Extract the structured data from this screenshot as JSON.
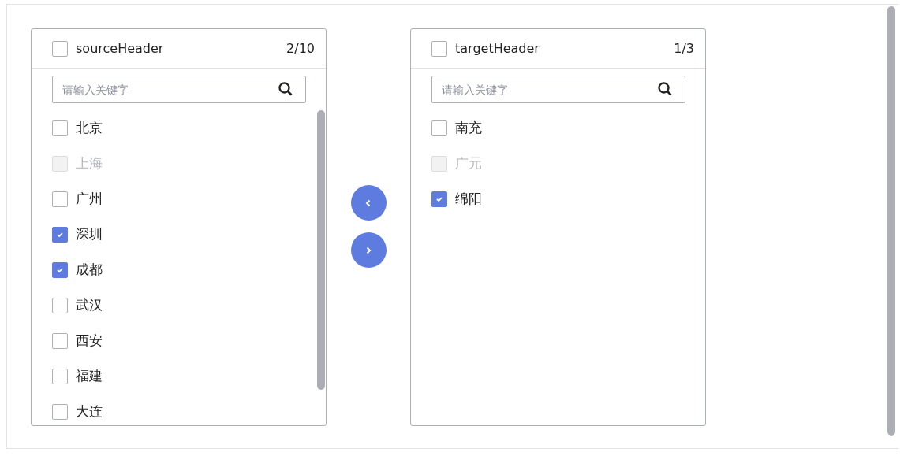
{
  "source": {
    "header": "sourceHeader",
    "checked": false,
    "count": "2/10",
    "placeholder": "请输入关键字",
    "items": [
      {
        "label": "北京",
        "checked": false,
        "disabled": false
      },
      {
        "label": "上海",
        "checked": false,
        "disabled": true
      },
      {
        "label": "广州",
        "checked": false,
        "disabled": false
      },
      {
        "label": "深圳",
        "checked": true,
        "disabled": false
      },
      {
        "label": "成都",
        "checked": true,
        "disabled": false
      },
      {
        "label": "武汉",
        "checked": false,
        "disabled": false
      },
      {
        "label": "西安",
        "checked": false,
        "disabled": false
      },
      {
        "label": "福建",
        "checked": false,
        "disabled": false
      },
      {
        "label": "大连",
        "checked": false,
        "disabled": false
      }
    ]
  },
  "buttons": [
    {
      "kind": "left"
    },
    {
      "kind": "right"
    }
  ],
  "target": {
    "header": "targetHeader",
    "checked": false,
    "count": "1/3",
    "placeholder": "请输入关键字",
    "items": [
      {
        "label": "南充",
        "checked": false,
        "disabled": false
      },
      {
        "label": "广元",
        "checked": false,
        "disabled": true
      },
      {
        "label": "绵阳",
        "checked": true,
        "disabled": false
      }
    ]
  }
}
